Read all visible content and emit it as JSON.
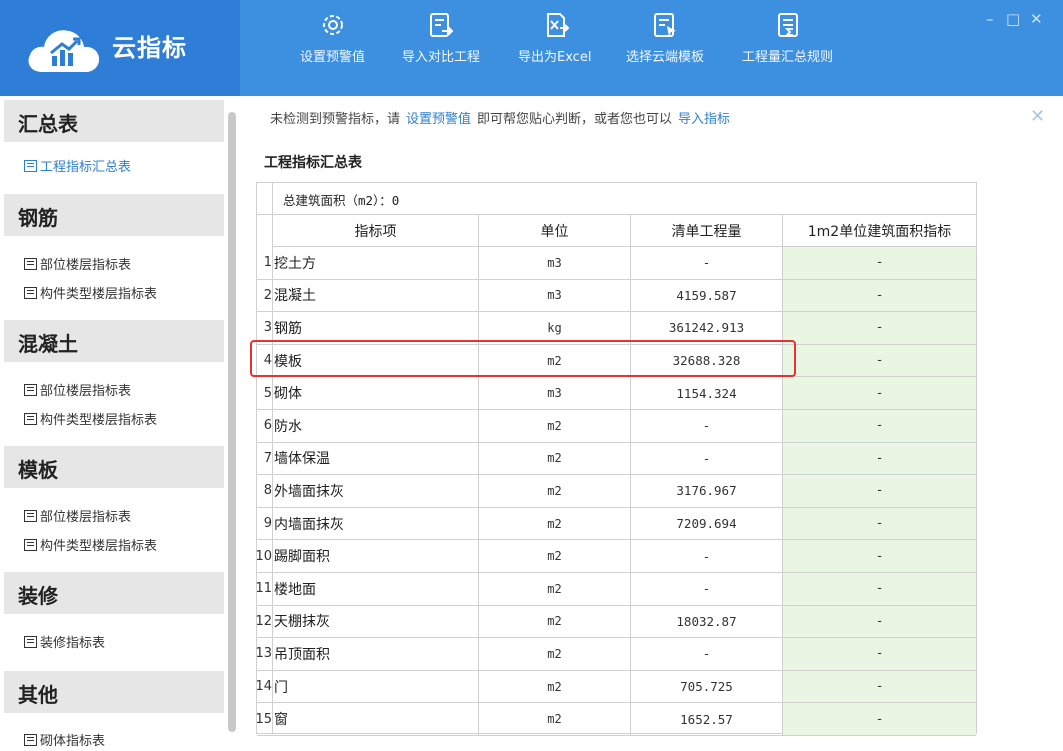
{
  "app": {
    "title": "云指标"
  },
  "toolbar": [
    {
      "label": "设置预警值",
      "icon": "gear-icon"
    },
    {
      "label": "导入对比工程",
      "icon": "import-icon"
    },
    {
      "label": "导出为Excel",
      "icon": "export-excel-icon"
    },
    {
      "label": "选择云端模板",
      "icon": "cloud-template-icon"
    },
    {
      "label": "工程量汇总规则",
      "icon": "summary-rule-icon"
    }
  ],
  "window_controls": {
    "minimize": "–",
    "maximize": "□",
    "close": "✕"
  },
  "sidebar": {
    "sections": [
      {
        "title": "汇总表",
        "items": [
          "工程指标汇总表"
        ]
      },
      {
        "title": "钢筋",
        "items": [
          "部位楼层指标表",
          "构件类型楼层指标表"
        ]
      },
      {
        "title": "混凝土",
        "items": [
          "部位楼层指标表",
          "构件类型楼层指标表"
        ]
      },
      {
        "title": "模板",
        "items": [
          "部位楼层指标表",
          "构件类型楼层指标表"
        ]
      },
      {
        "title": "装修",
        "items": [
          "装修指标表"
        ]
      },
      {
        "title": "其他",
        "items": [
          "砌体指标表"
        ]
      }
    ]
  },
  "notice": {
    "text1": "未检测到预警指标，请",
    "link1": "设置预警值",
    "text2": "即可帮您贴心判断，或者您也可以",
    "link2": "导入指标",
    "close": "✕"
  },
  "table": {
    "title": "工程指标汇总表",
    "summary": "总建筑面积（m2）：0",
    "headers": [
      "指标项",
      "单位",
      "清单工程量",
      "1m2单位建筑面积指标"
    ],
    "rows": [
      {
        "no": "1",
        "name": "挖土方",
        "unit": "m3",
        "qty": "-",
        "index": "-"
      },
      {
        "no": "2",
        "name": "混凝土",
        "unit": "m3",
        "qty": "4159.587",
        "index": "-"
      },
      {
        "no": "3",
        "name": "钢筋",
        "unit": "kg",
        "qty": "361242.913",
        "index": "-"
      },
      {
        "no": "4",
        "name": "模板",
        "unit": "m2",
        "qty": "32688.328",
        "index": "-"
      },
      {
        "no": "5",
        "name": "砌体",
        "unit": "m3",
        "qty": "1154.324",
        "index": "-"
      },
      {
        "no": "6",
        "name": "防水",
        "unit": "m2",
        "qty": "-",
        "index": "-"
      },
      {
        "no": "7",
        "name": "墙体保温",
        "unit": "m2",
        "qty": "-",
        "index": "-"
      },
      {
        "no": "8",
        "name": "外墙面抹灰",
        "unit": "m2",
        "qty": "3176.967",
        "index": "-"
      },
      {
        "no": "9",
        "name": "内墙面抹灰",
        "unit": "m2",
        "qty": "7209.694",
        "index": "-"
      },
      {
        "no": "10",
        "name": "踢脚面积",
        "unit": "m2",
        "qty": "-",
        "index": "-"
      },
      {
        "no": "11",
        "name": "楼地面",
        "unit": "m2",
        "qty": "-",
        "index": "-"
      },
      {
        "no": "12",
        "name": "天棚抹灰",
        "unit": "m2",
        "qty": "18032.87",
        "index": "-"
      },
      {
        "no": "13",
        "name": "吊顶面积",
        "unit": "m2",
        "qty": "-",
        "index": "-"
      },
      {
        "no": "14",
        "name": "门",
        "unit": "m2",
        "qty": "705.725",
        "index": "-"
      },
      {
        "no": "15",
        "name": "窗",
        "unit": "m2",
        "qty": "1652.57",
        "index": "-"
      }
    ]
  },
  "colors": {
    "header_blue": "#3d8fe0",
    "logo_blue": "#2e7dd6",
    "link": "#2f7fd1",
    "index_bg": "#e9f7e2",
    "highlight": "#e53333"
  }
}
